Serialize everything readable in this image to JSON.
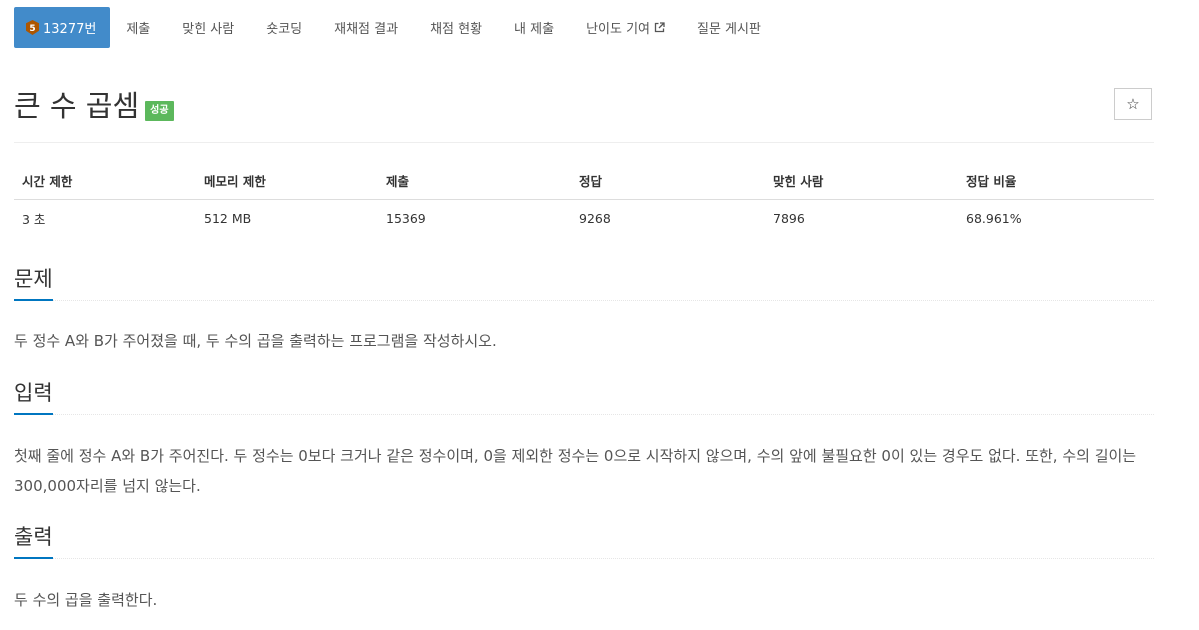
{
  "nav": {
    "problem_number": "13277번",
    "badge_level": "5",
    "badge_color": "#ad5600",
    "active_color": "#428bca",
    "items": [
      {
        "label": "제출"
      },
      {
        "label": "맞힌 사람"
      },
      {
        "label": "숏코딩"
      },
      {
        "label": "재채점 결과"
      },
      {
        "label": "채점 현황"
      },
      {
        "label": "내 제출"
      },
      {
        "label": "난이도 기여",
        "icon": "external-link-icon"
      },
      {
        "label": "질문 게시판"
      }
    ]
  },
  "problem": {
    "title": "큰 수 곱셈",
    "result_label": "성공",
    "result_color": "#5cb85c",
    "star_icon": "☆"
  },
  "info": {
    "headers": [
      "시간 제한",
      "메모리 제한",
      "제출",
      "정답",
      "맞힌 사람",
      "정답 비율"
    ],
    "values": [
      "3 초",
      "512 MB",
      "15369",
      "9268",
      "7896",
      "68.961%"
    ]
  },
  "sections": {
    "description": {
      "title": "문제",
      "text": "두 정수 A와 B가 주어졌을 때, 두 수의 곱을 출력하는 프로그램을 작성하시오."
    },
    "input": {
      "title": "입력",
      "text": "첫째 줄에 정수 A와 B가 주어진다. 두 정수는 0보다 크거나 같은 정수이며, 0을 제외한 정수는 0으로 시작하지 않으며, 수의 앞에 불필요한 0이 있는 경우도 없다. 또한, 수의 길이는 300,000자리를 넘지 않는다."
    },
    "output": {
      "title": "출력",
      "text": "두 수의 곱을 출력한다."
    }
  }
}
